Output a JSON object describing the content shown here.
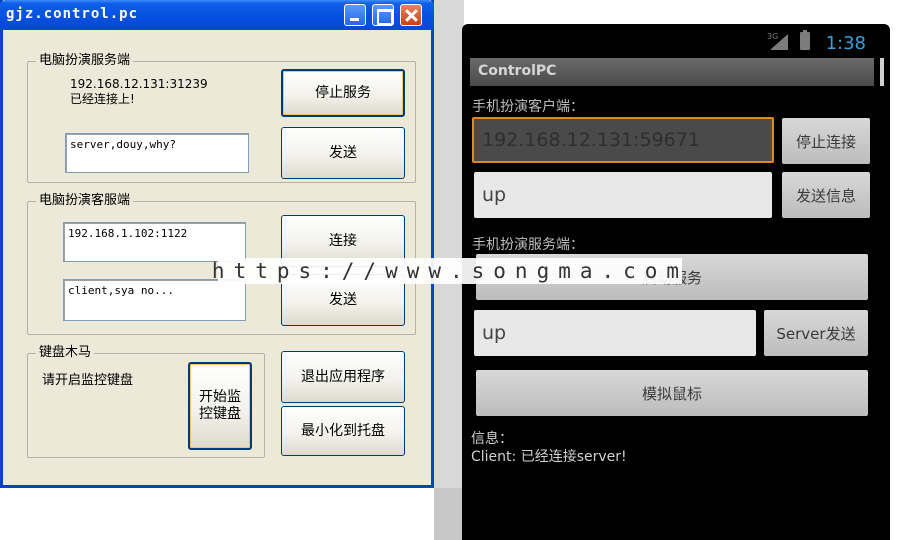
{
  "window": {
    "title": "gjz.control.pc",
    "server_group": {
      "legend": "电脑扮演服务端",
      "status_address": "192.168.12.131:31239",
      "status_text": "已经连接上!",
      "stop_button": "停止服务",
      "message": "server,douy,why?",
      "send_button": "发送"
    },
    "client_group": {
      "legend": "电脑扮演客服端",
      "address": "192.168.1.102:1122",
      "connect_button": "连接",
      "message": "client,sya no...",
      "send_button": "发送"
    },
    "keylogger_group": {
      "legend": "键盘木马",
      "hint": "请开启监控键盘",
      "start_button": "开始监\n控键盘"
    },
    "exit_button": "退出应用程序",
    "minimize_button": "最小化到托盘"
  },
  "android": {
    "status_bar": {
      "time": "1:38",
      "network": "3G"
    },
    "app_title": "ControlPC",
    "client_section": {
      "label": "手机扮演客户端：",
      "address": "192.168.12.131:59671",
      "stop_button": "停止连接",
      "message": "up",
      "send_button": "发送信息"
    },
    "server_section": {
      "label": "手机扮演服务端：",
      "start_button": "启动服务",
      "message": "up",
      "send_button": "Server发送"
    },
    "mouse_button": "模拟鼠标",
    "info_label": "信息：",
    "info_text": "Client: 已经连接server!"
  },
  "watermark": "https://www.songma.com",
  "colors": {
    "xp_title_blue": "#0550e0",
    "xp_face": "#ece9d8",
    "android_time": "#39a0d8",
    "focus_orange": "#e08a1c"
  }
}
